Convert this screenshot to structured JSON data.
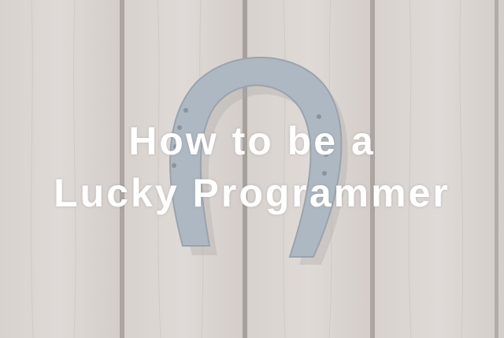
{
  "title": {
    "line1": "How to be a",
    "line2": "Lucky Programmer"
  },
  "colors": {
    "wood": "#cbc3be",
    "wood_dark": "#b9b0aa",
    "plank_gap": "#7d7470",
    "horseshoe": "#8a9aa8",
    "horseshoe_dark": "#6f7f8d",
    "overlay": "#ffffff"
  },
  "image": {
    "subject": "horseshoe-on-wooden-planks"
  }
}
